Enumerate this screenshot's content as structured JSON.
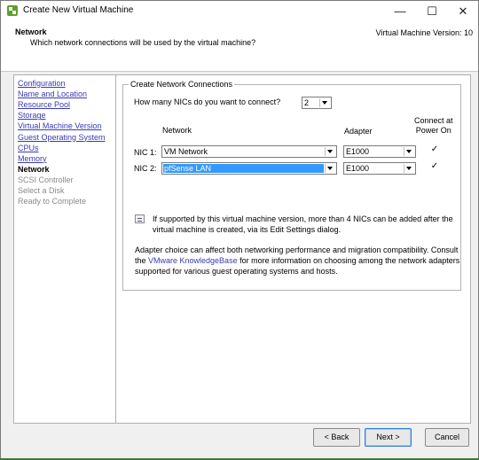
{
  "window": {
    "title": "Create New Virtual Machine",
    "min_symbol": "—",
    "max_symbol": "☐",
    "close_symbol": "✕"
  },
  "header": {
    "title": "Network",
    "subtitle": "Which network connections will be used by the virtual machine?",
    "version": "Virtual Machine Version: 10"
  },
  "sidebar": {
    "items": [
      {
        "label": "Configuration",
        "state": "link"
      },
      {
        "label": "Name and Location",
        "state": "link"
      },
      {
        "label": "Resource Pool",
        "state": "link"
      },
      {
        "label": "Storage",
        "state": "link"
      },
      {
        "label": "Virtual Machine Version",
        "state": "link"
      },
      {
        "label": "Guest Operating System",
        "state": "link"
      },
      {
        "label": "CPUs",
        "state": "link"
      },
      {
        "label": "Memory",
        "state": "link"
      },
      {
        "label": "Network",
        "state": "active"
      },
      {
        "label": "SCSI Controller",
        "state": "disabled"
      },
      {
        "label": "Select a Disk",
        "state": "disabled"
      },
      {
        "label": "Ready to Complete",
        "state": "disabled"
      }
    ]
  },
  "main": {
    "group_title": "Create Network Connections",
    "nic_question": "How many NICs do you want to connect?",
    "nic_count": "2",
    "col_network": "Network",
    "col_adapter": "Adapter",
    "col_connect": "Connect at\nPower On",
    "nics": [
      {
        "label": "NIC 1:",
        "network": "VM Network",
        "adapter": "E1000",
        "connect": "✓"
      },
      {
        "label": "NIC 2:",
        "network": "pfSense LAN",
        "adapter": "E1000",
        "connect": "✓"
      }
    ],
    "info_line1": "If supported by this virtual machine version, more than 4 NICs can be added after the",
    "info_line2": "virtual machine is created, via its Edit Settings dialog.",
    "adapter_line1": "Adapter choice can affect both networking performance and migration compatibility. Consult",
    "adapter_line2_pre": "the ",
    "adapter_link": "VMware KnowledgeBase",
    "adapter_line2_post": " for more information on choosing among the network adapters",
    "adapter_line3": "supported for various guest operating systems and hosts."
  },
  "buttons": {
    "back": "< Back",
    "next": "Next >",
    "cancel": "Cancel"
  },
  "colors": {
    "link": "#3a3ab4",
    "selection": "#3399ff",
    "app_icon": "#5aa02c"
  }
}
